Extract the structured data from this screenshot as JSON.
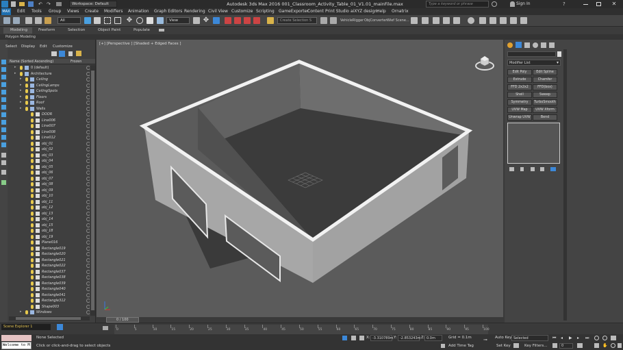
{
  "titlebar": {
    "workspace": "Workspace: Default",
    "title": "Autodesk 3ds Max 2016   001_Classroom_Activity_Table_01_V1.01_mainFile.max",
    "search_placeholder": "Type a keyword or phrase",
    "sign_in": "Sign In"
  },
  "menu": [
    "Edit",
    "Tools",
    "Group",
    "Views",
    "Create",
    "Modifiers",
    "Animation",
    "Graph Editors",
    "Rendering",
    "Civil View",
    "Customize",
    "Scripting",
    "GameExporter",
    "Content",
    "Print Studio",
    "aiXYZ design",
    "Help",
    "Ornatrix"
  ],
  "toolbar": {
    "selection_filter": "All",
    "view_dropdown": "View",
    "named_selection": "Create Selection S",
    "vehiclerigger": "VehicleRigger",
    "objconverter": "ObjConverter",
    "wireframe_scene": "Wief Scene..."
  },
  "ribbon": {
    "tabs": [
      "Modeling",
      "Freeform",
      "Selection",
      "Object Paint",
      "Populate"
    ],
    "sub_label": "Polygon Modeling"
  },
  "explorer": {
    "menu": [
      "Select",
      "Display",
      "Edit",
      "Customize"
    ],
    "col_name": "Name (Sorted Ascending)",
    "col_frozen": "Frozen",
    "rows": [
      {
        "label": "0 (default)",
        "indent": 0
      },
      {
        "label": "Architecture",
        "indent": 0
      },
      {
        "label": "Ceiling",
        "indent": 1
      },
      {
        "label": "CeilingLamps",
        "indent": 1
      },
      {
        "label": "CeilingSpots",
        "indent": 1
      },
      {
        "label": "Floors",
        "indent": 1
      },
      {
        "label": "Roof",
        "indent": 1
      },
      {
        "label": "Walls",
        "indent": 1
      },
      {
        "label": "DOOR",
        "indent": 2
      },
      {
        "label": "Line006",
        "indent": 2
      },
      {
        "label": "Line007",
        "indent": 2
      },
      {
        "label": "Line008",
        "indent": 2
      },
      {
        "label": "Line012",
        "indent": 2
      },
      {
        "label": "obj_01",
        "indent": 2
      },
      {
        "label": "obj_02",
        "indent": 2
      },
      {
        "label": "obj_03",
        "indent": 2
      },
      {
        "label": "obj_04",
        "indent": 2
      },
      {
        "label": "obj_05",
        "indent": 2
      },
      {
        "label": "obj_06",
        "indent": 2
      },
      {
        "label": "obj_07",
        "indent": 2
      },
      {
        "label": "obj_08",
        "indent": 2
      },
      {
        "label": "obj_09",
        "indent": 2
      },
      {
        "label": "obj_10",
        "indent": 2
      },
      {
        "label": "obj_11",
        "indent": 2
      },
      {
        "label": "obj_12",
        "indent": 2
      },
      {
        "label": "obj_13",
        "indent": 2
      },
      {
        "label": "obj_14",
        "indent": 2
      },
      {
        "label": "obj_15",
        "indent": 2
      },
      {
        "label": "obj_18",
        "indent": 2
      },
      {
        "label": "obj_19",
        "indent": 2
      },
      {
        "label": "Plane016",
        "indent": 2
      },
      {
        "label": "Rectangle019",
        "indent": 2
      },
      {
        "label": "Rectangle020",
        "indent": 2
      },
      {
        "label": "Rectangle021",
        "indent": 2
      },
      {
        "label": "Rectangle022",
        "indent": 2
      },
      {
        "label": "Rectangle037",
        "indent": 2
      },
      {
        "label": "Rectangle038",
        "indent": 2
      },
      {
        "label": "Rectangle039",
        "indent": 2
      },
      {
        "label": "Rectangle040",
        "indent": 2
      },
      {
        "label": "Rectangle041",
        "indent": 2
      },
      {
        "label": "Rectangle312",
        "indent": 2
      },
      {
        "label": "Shape003",
        "indent": 2
      },
      {
        "label": "Windows",
        "indent": 1
      }
    ],
    "footer": "Scene Explorer 1"
  },
  "viewport": {
    "label": "[+] [Perspective ] [Shaded + Edged Faces ]"
  },
  "cmdpanel": {
    "modifier_list": "Modifier List",
    "buttons": [
      "Edit Poly",
      "Edit Spline",
      "Extrude",
      "Chamfer",
      "FFD 2x2x2",
      "FFD(box)",
      "Shell",
      "Sweep",
      "Symmetry",
      "TurboSmooth",
      "UVW Map",
      "UVW Xform",
      "Unwrap UVW",
      "Bend"
    ]
  },
  "timeline": {
    "frame": "0 / 100",
    "ticks": [
      "0",
      "5",
      "10",
      "15",
      "20",
      "25",
      "30",
      "35",
      "40",
      "45",
      "50",
      "55",
      "60",
      "65",
      "70",
      "75",
      "80",
      "85",
      "90",
      "95",
      "100"
    ]
  },
  "status": {
    "maxscript": "Welcome to M",
    "selected": "None Selected",
    "hint": "Click or click-and-drag to select objects",
    "x_label": "X:",
    "x_val": "-3.310789m",
    "y_label": "Y:",
    "y_val": "-2.853243m",
    "z_label": "Z:",
    "z_val": "0.0m",
    "grid": "Grid = 0.1m",
    "add_time_tag": "Add Time Tag",
    "auto_key": "Auto Key",
    "set_key": "Set Key",
    "selected_dropdown": "Selected",
    "key_filters": "Key Filters...",
    "frame_field": "0"
  }
}
